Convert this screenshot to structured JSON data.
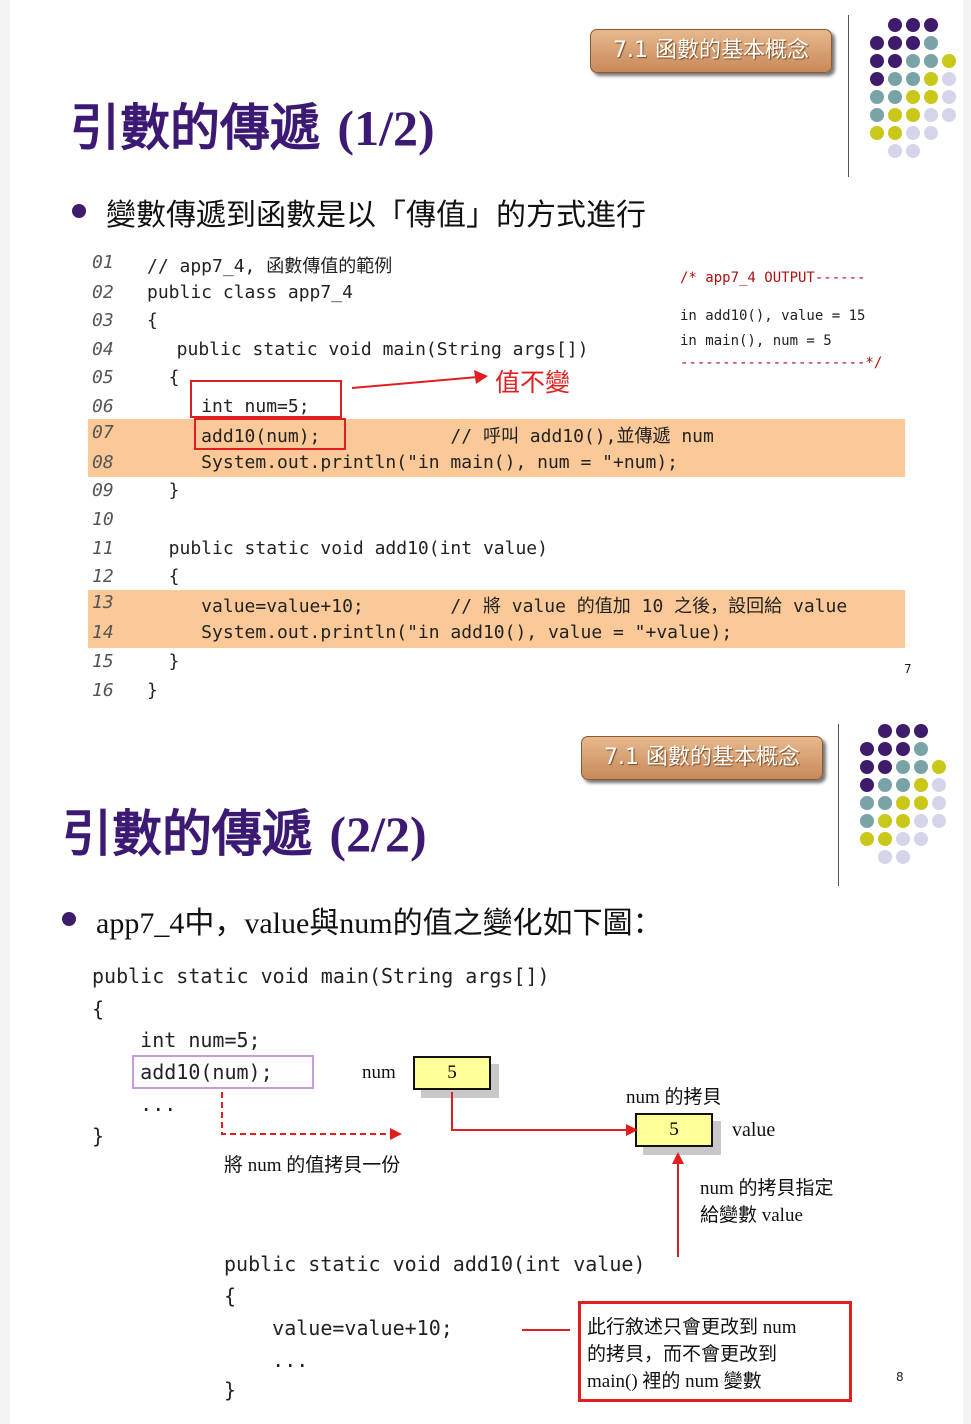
{
  "slide1": {
    "badge": "7.1 函數的基本概念",
    "title_text": "引數的傳遞",
    "title_num": "(1/2)",
    "bullet": "變數傳遞到函數是以「傳值」的方式進行",
    "line_numbers": [
      "01",
      "02",
      "03",
      "04",
      "05",
      "06",
      "07",
      "08",
      "09",
      "10",
      "11",
      "12",
      "13",
      "14",
      "15",
      "16"
    ],
    "code_lines": [
      "// app7_4, 函數傳值的範例",
      "public class app7_4",
      "{",
      "  public static void main(String args[])",
      "  {",
      "     int num=5;",
      "     add10(num);            // 呼叫 add10(),並傳遞 num",
      "     System.out.println(\"in main(), num = \"+num);",
      "  }",
      "",
      "  public static void add10(int value)",
      "  {",
      "     value=value+10;        // 將 value 的值加 10 之後，設回給 value",
      "     System.out.println(\"in add10(), value = \"+value);",
      "  }",
      "}"
    ],
    "output": {
      "header": "/* app7_4 OUTPUT------",
      "line1": "in add10(), value = 15",
      "line2": "in main(), num = 5",
      "footer": "----------------------*/"
    },
    "annotation": "值不變",
    "page_number": "7"
  },
  "slide2": {
    "badge": "7.1 函數的基本概念",
    "title_text": "引數的傳遞",
    "title_num": "(2/2)",
    "bullet": "app7_4中，value與num的值之變化如下圖：",
    "code_main": [
      "public static void main(String args[])",
      "{",
      "    int num=5;",
      "    add10(num);",
      "    ...",
      "}"
    ],
    "code_add10": [
      "public static void add10(int value)",
      "{",
      "    value=value+10;",
      "    ...",
      "}"
    ],
    "num_label": "num",
    "num_value": "5",
    "copy_label": "num 的拷貝",
    "copy_value": "5",
    "value_label": "value",
    "copy_note": "將 num 的值拷貝一份",
    "assign_note_1": "num 的拷貝指定",
    "assign_note_2": "給變數 value",
    "effect_note_1": "此行敘述只會更改到  num",
    "effect_note_2": "的拷貝，而不會更改到",
    "effect_note_3": "main()  裡的 num 變數",
    "page_number": "8"
  },
  "colors": {
    "title": "#3c1a74",
    "highlight_band": "#fbc997",
    "annotation_red": "#e02020",
    "badge": "#d9a070",
    "dot_purple": "#3e1c6b",
    "dot_teal": "#7aa3a8",
    "dot_yellow": "#c8c818",
    "dot_lavender": "#d4d4ea"
  }
}
